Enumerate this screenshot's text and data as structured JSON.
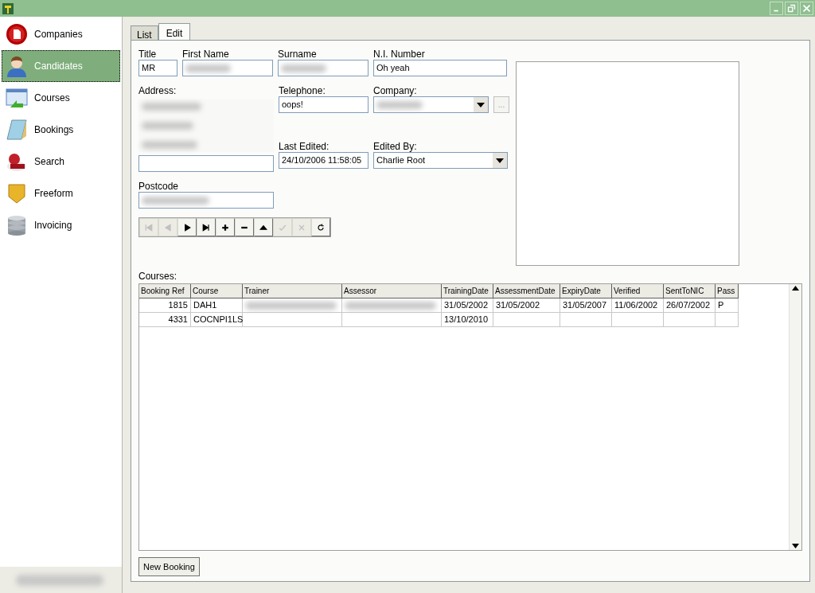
{
  "sidebar": {
    "items": [
      {
        "label": "Companies",
        "selected": false
      },
      {
        "label": "Candidates",
        "selected": true
      },
      {
        "label": "Courses",
        "selected": false
      },
      {
        "label": "Bookings",
        "selected": false
      },
      {
        "label": "Search",
        "selected": false
      },
      {
        "label": "Freeform",
        "selected": false
      },
      {
        "label": "Invoicing",
        "selected": false
      }
    ]
  },
  "tabs": [
    {
      "label": "List",
      "selected": false
    },
    {
      "label": "Edit",
      "selected": true
    }
  ],
  "form": {
    "title": {
      "label": "Title",
      "value": "MR"
    },
    "first_name": {
      "label": "First Name",
      "redacted": true
    },
    "surname": {
      "label": "Surname",
      "redacted": true
    },
    "ni_number": {
      "label": "N.I. Number",
      "value": "Oh yeah"
    },
    "address": {
      "label": "Address:",
      "redacted": true
    },
    "telephone": {
      "label": "Telephone:",
      "value": "oops!"
    },
    "company": {
      "label": "Company:",
      "redacted": true,
      "browse": "..."
    },
    "last_edited": {
      "label": "Last Edited:",
      "value": "24/10/2006 11:58:05"
    },
    "edited_by": {
      "label": "Edited By:",
      "value": "Charlie Root"
    },
    "postcode": {
      "label": "Postcode",
      "redacted": true
    }
  },
  "navigator": [
    {
      "disabled": true
    },
    {
      "disabled": true
    },
    {
      "disabled": false
    },
    {
      "disabled": false
    },
    {
      "disabled": false
    },
    {
      "disabled": false
    },
    {
      "disabled": false
    },
    {
      "disabled": true
    },
    {
      "disabled": true
    },
    {
      "disabled": false
    }
  ],
  "courses": {
    "label": "Courses:",
    "columns": [
      "Booking Ref",
      "Course",
      "Trainer",
      "Assessor",
      "TrainingDate",
      "AssessmentDate",
      "ExpiryDate",
      "Verified",
      "SentToNIC",
      "Pass"
    ],
    "rows": [
      {
        "redacted": true,
        "cells": {
          "0": "1815",
          "1": "DAH1",
          "4": "31/05/2002",
          "5": "31/05/2002",
          "6": "31/05/2007",
          "7": "11/06/2002",
          "8": "26/07/2002",
          "9": "P"
        }
      },
      {
        "redacted": false,
        "cells": {
          "0": "4331",
          "1": "COCNPI1LS",
          "4": "13/10/2010"
        }
      }
    ]
  },
  "new_booking_button": "New Booking"
}
